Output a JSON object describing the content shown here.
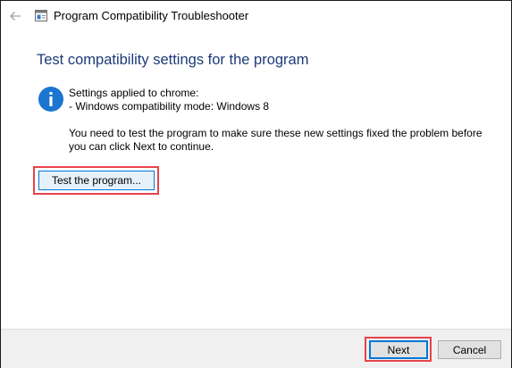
{
  "window": {
    "title": "Program Compatibility Troubleshooter"
  },
  "content": {
    "heading": "Test compatibility settings for the program",
    "settings_header": "Settings applied to chrome:",
    "settings_item": "- Windows compatibility mode: Windows 8",
    "message_line1": "You need to test the program to make sure these new settings fixed the problem before",
    "message_line2": "you can click Next to continue.",
    "test_button_label": "Test the program..."
  },
  "footer": {
    "next_label": "Next",
    "cancel_label": "Cancel"
  },
  "icons": {
    "back": "back-arrow-icon",
    "app": "troubleshooter-app-icon",
    "info": "info-icon"
  },
  "colors": {
    "heading": "#1c3a78",
    "info_icon": "#1c75d0",
    "highlight": "#e8434b",
    "button_focus": "#0078d7",
    "footer_bg": "#f0f0f0"
  }
}
